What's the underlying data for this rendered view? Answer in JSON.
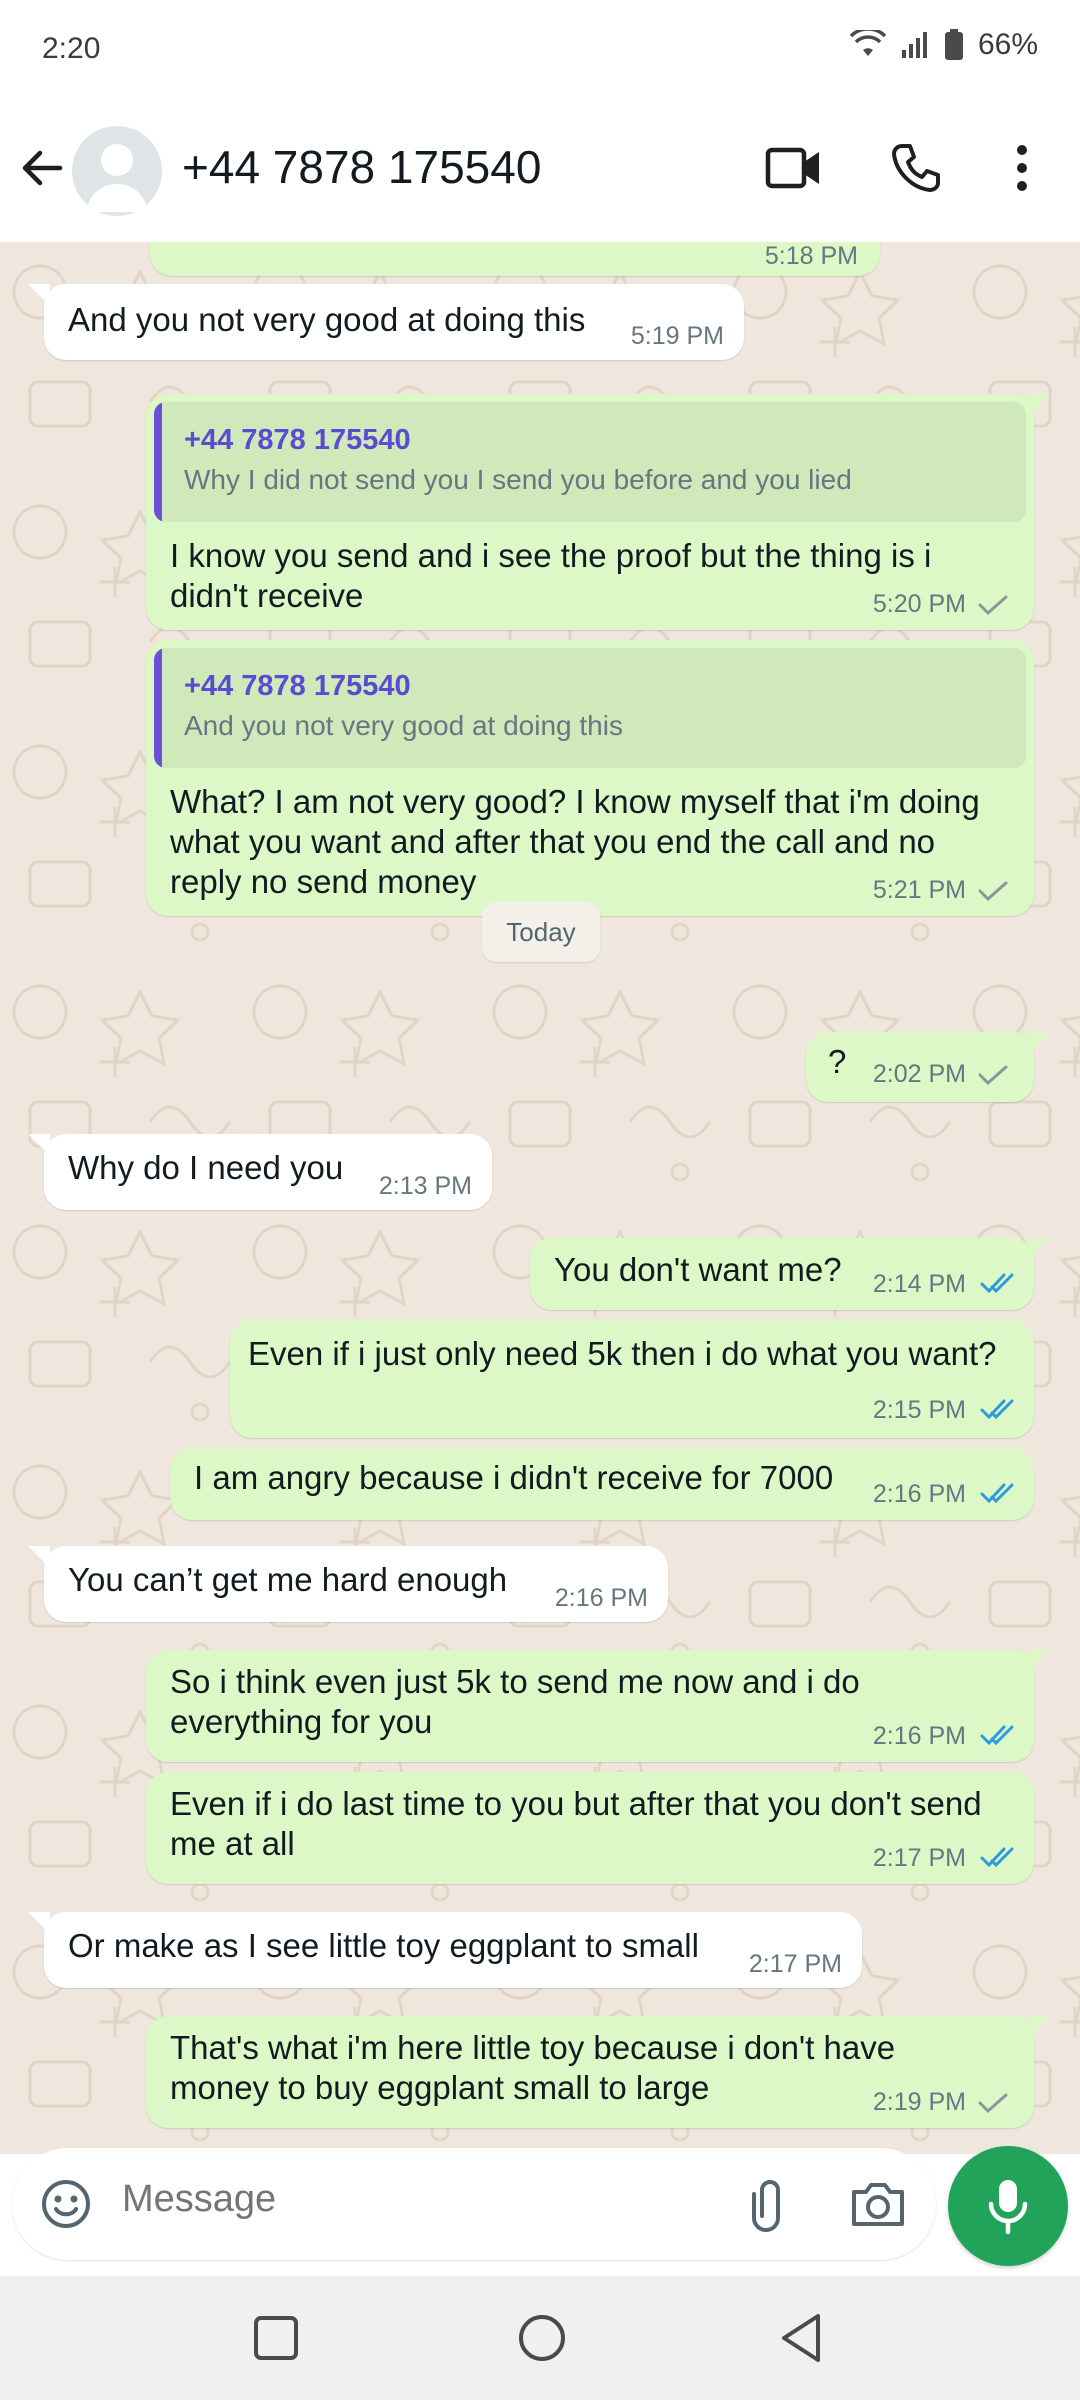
{
  "status_bar": {
    "time": "2:20",
    "battery": "66%"
  },
  "header": {
    "contact": "+44 7878 175540"
  },
  "messages": [
    {
      "time": "5:18 PM"
    },
    {
      "text": "And you not very good at doing this",
      "time": "5:19 PM"
    },
    {
      "quote_sender": "+44 7878 175540",
      "quote_text": "Why I did not send you I send you before and you lied",
      "line1": "I know you send and i see the proof but the thing is i",
      "line2": "didn't receive",
      "time": "5:20 PM"
    },
    {
      "quote_sender": "+44 7878 175540",
      "quote_text": "And you not very good at doing this",
      "line1": "What? I am not very good? I know myself that i'm doing",
      "line2": "what you want and after that you end the call and no",
      "line3": "reply no send money",
      "time": "5:21 PM"
    },
    {
      "text": "?",
      "time": "2:02 PM"
    },
    {
      "text": "Why do I need you",
      "time": "2:13 PM"
    },
    {
      "text": "You don't want me?",
      "time": "2:14 PM"
    },
    {
      "text": "Even if i just only need 5k then i do what you want?",
      "time": "2:15 PM"
    },
    {
      "text": "I am angry because i didn't receive for 7000",
      "time": "2:16 PM"
    },
    {
      "text": "You can’t get me hard enough",
      "time": "2:16 PM"
    },
    {
      "line1": "So i think even just 5k to send me now and i do",
      "line2": "everything for you",
      "time": "2:16 PM"
    },
    {
      "line1": "Even if i do last time to you but after that you don't send",
      "line2": "me at all",
      "time": "2:17 PM"
    },
    {
      "text": "Or make as I see little toy eggplant to small",
      "time": "2:17 PM"
    },
    {
      "line1": "That's what i'm here little toy because i don't have",
      "line2": "money to buy eggplant small to large",
      "time": "2:19 PM"
    }
  ],
  "day_chip": "Today",
  "composer": {
    "placeholder": "Message"
  },
  "icons": {
    "back": "arrow-left-icon",
    "video": "video-camera-icon",
    "call": "phone-icon",
    "menu": "more-vert-icon",
    "emoji": "emoji-icon",
    "attach": "paperclip-icon",
    "camera": "camera-icon",
    "mic": "microphone-icon"
  },
  "colors": {
    "outgoing": "#dcf8c6",
    "incoming": "#ffffff",
    "chat_bg": "#efe7dd",
    "read_tick": "#2e9bdc",
    "mic": "#21a35a",
    "quote_bar": "#6b4fd9"
  }
}
